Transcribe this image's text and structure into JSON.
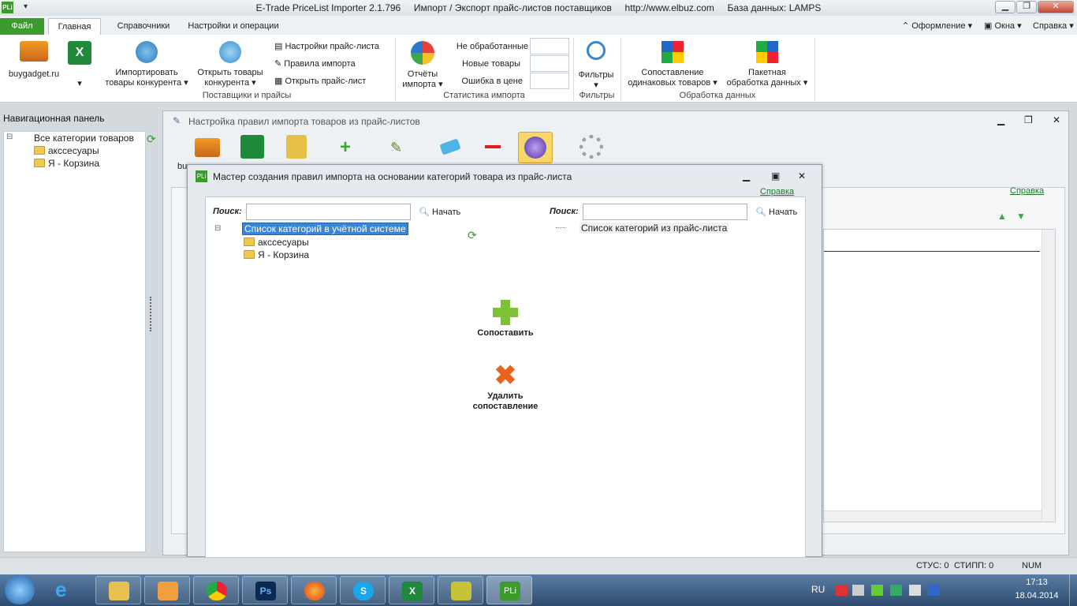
{
  "titlebar": {
    "app_title": "E-Trade PriceList Importer 2.1.796     Импорт / Экспорт прайс-листов поставщиков     http://www.elbuz.com     База данных: LAMPS",
    "logo": "PLi"
  },
  "tabs": [
    {
      "label": "Файл"
    },
    {
      "label": "Главная"
    },
    {
      "label": "Справочники"
    },
    {
      "label": "Настройки и операции"
    }
  ],
  "right_menu": {
    "appearance": "Оформление",
    "windows": "Окна",
    "help": "Справка"
  },
  "ribbon": {
    "buygadget": "buygadget.ru",
    "import_competitor": [
      "Импортировать",
      "товары конкурента"
    ],
    "open_competitor": [
      "Открыть товары",
      "конкурента"
    ],
    "small_buttons": [
      "Настройки прайс-листа",
      "Правила импорта",
      "Открыть прайс-лист"
    ],
    "group_suppliers": "Поставщики и прайсы",
    "reports": [
      "Отчёты",
      "импорта"
    ],
    "stats": [
      "Не обработанные",
      "Новые товары",
      "Ошибка в цене"
    ],
    "group_stats": "Статистика импорта",
    "filters": "Фильтры",
    "group_filters": "Фильтры",
    "compare_same": [
      "Сопоставление",
      "одинаковых товаров"
    ],
    "batch": [
      "Пакетная",
      "обработка данных"
    ],
    "group_processing": "Обработка данных"
  },
  "nav": {
    "title": "Навигационная панель",
    "tree": [
      "Все категории товаров",
      "акссесуары",
      "Я - Корзина"
    ]
  },
  "mdi": {
    "title": "Настройка правил импорта товаров из прайс-листов",
    "toolbar_label": "bu",
    "help": "Справка"
  },
  "wizard": {
    "title": "Мастер создания правил импорта на основании категорий товара из прайс-листа",
    "help": "Справка",
    "search_label": "Поиск:",
    "search_button": "Начать",
    "left_root": "Список категорий в учётной системе",
    "left_children": [
      "акссесуары",
      "Я - Корзина"
    ],
    "right_root": "Список категорий из прайс-листа",
    "compare": "Сопоставить",
    "delete_compare": [
      "Удалить",
      "сопоставление"
    ]
  },
  "statusbar": {
    "stus": "СТУС: 0",
    "stipp": "СТИПП: 0",
    "num": "NUM"
  },
  "taskbar": {
    "lang": "RU",
    "time": "17:13",
    "date": "18.04.2014"
  }
}
